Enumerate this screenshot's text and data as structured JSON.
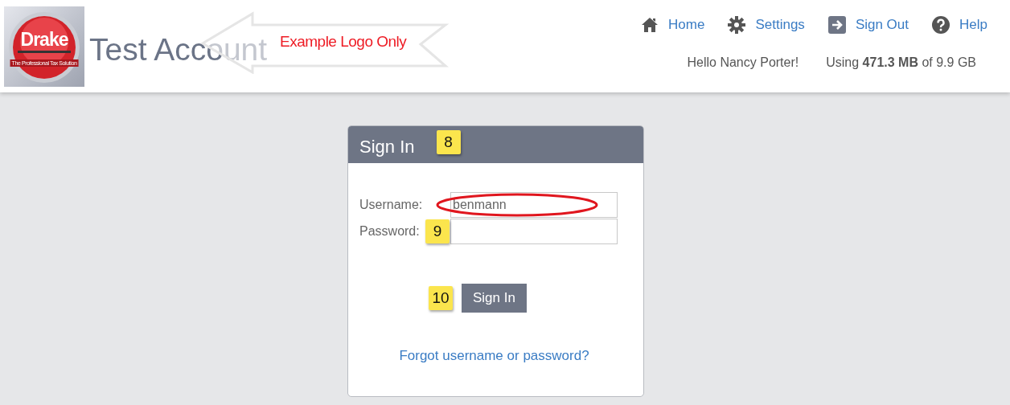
{
  "header": {
    "logo": {
      "name": "Drake",
      "tagline": "The Professional Tax Solution"
    },
    "title": "Test Account",
    "nav": [
      {
        "kind": "home",
        "label": "Home"
      },
      {
        "kind": "settings",
        "label": "Settings"
      },
      {
        "kind": "signout",
        "label": "Sign Out"
      },
      {
        "kind": "help",
        "label": "Help"
      }
    ],
    "greeting": "Hello Nancy Porter!",
    "usage": "Using **471.3 MB** of 9.9 GB"
  },
  "sign_in": {
    "title": "Sign In",
    "fields": [
      {
        "label": "Username:",
        "value": "benmann"
      },
      {
        "label": "Password:"
      }
    ],
    "button": "Sign In",
    "link": "Forgot username or password?"
  },
  "annotations": {
    "callout": "Example Logo Only",
    "badges": [
      "8",
      "9",
      "10"
    ]
  }
}
